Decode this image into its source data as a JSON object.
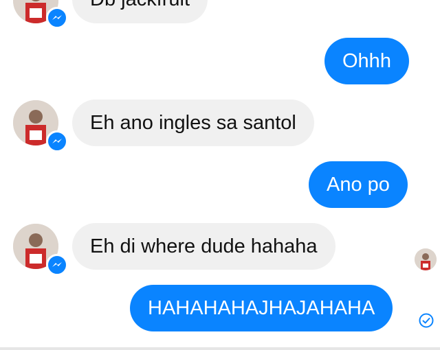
{
  "messages": [
    {
      "side": "in",
      "text": "Db jackfruit"
    },
    {
      "side": "out",
      "text": "Ohhh"
    },
    {
      "side": "in",
      "text": "Eh ano ingles sa santol"
    },
    {
      "side": "out",
      "text": "Ano po"
    },
    {
      "side": "in",
      "text": "Eh di where dude hahaha"
    },
    {
      "side": "out",
      "text": "HAHAHAHAJHAJAHAHA"
    }
  ],
  "colors": {
    "outgoing_bubble": "#0a84ff",
    "incoming_bubble": "#f0f0f0",
    "messenger_badge": "#0a84ff"
  },
  "icons": {
    "badge": "messenger-icon",
    "status": "delivered-check-icon",
    "seen": "seen-avatar"
  }
}
